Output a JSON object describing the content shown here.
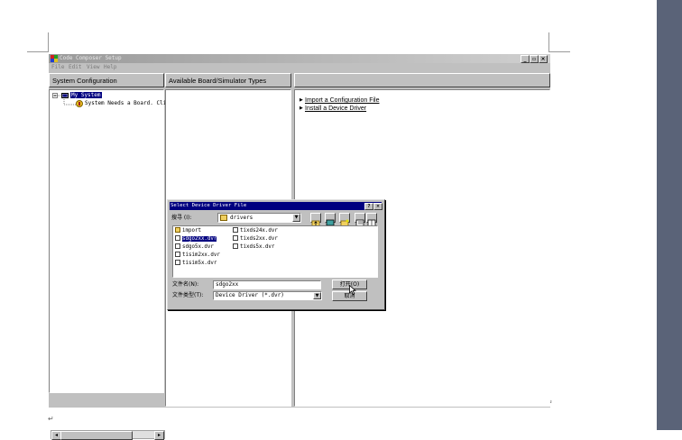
{
  "window": {
    "title": "Code Composer Setup",
    "controls": {
      "minimize": "_",
      "maximize": "▫",
      "close": "×"
    }
  },
  "menu": [
    "File",
    "Edit",
    "View",
    "Help"
  ],
  "headers": {
    "system_config": "System Configuration",
    "available_types": "Available Board/Simulator Types",
    "third": ""
  },
  "tree": {
    "root": "My System",
    "child": "System Needs a Board. Click"
  },
  "links": {
    "import": "Import a Configuration File",
    "install": "Install a Device Driver"
  },
  "dialog": {
    "title": "Select Device Driver File",
    "help": "?",
    "close": "×",
    "lookin_label": "搜寻 (I):",
    "lookin_value": "drivers",
    "files_col1": [
      {
        "name": "import",
        "type": "folder",
        "selected": false
      },
      {
        "name": "sdgo2xx.dvr",
        "type": "file",
        "selected": true
      },
      {
        "name": "sdgo5x.dvr",
        "type": "file",
        "selected": false
      },
      {
        "name": "tisim2xx.dvr",
        "type": "file",
        "selected": false
      },
      {
        "name": "tisim5x.dvr",
        "type": "file",
        "selected": false
      }
    ],
    "files_col2": [
      {
        "name": "tixds24x.dvr",
        "type": "file"
      },
      {
        "name": "tixds2xx.dvr",
        "type": "file"
      },
      {
        "name": "tixds5x.dvr",
        "type": "file"
      }
    ],
    "filename_label": "文件名(N):",
    "filename_value": "sdgo2xx",
    "filetype_label": "文件类型(T):",
    "filetype_value": "Device Driver (*.dvr)",
    "open_label": "打开(O)",
    "cancel_label": "取消"
  },
  "colors": {
    "titlebar_active": "#000080",
    "face": "#c0c0c0",
    "page_edge": "#5a6378"
  }
}
